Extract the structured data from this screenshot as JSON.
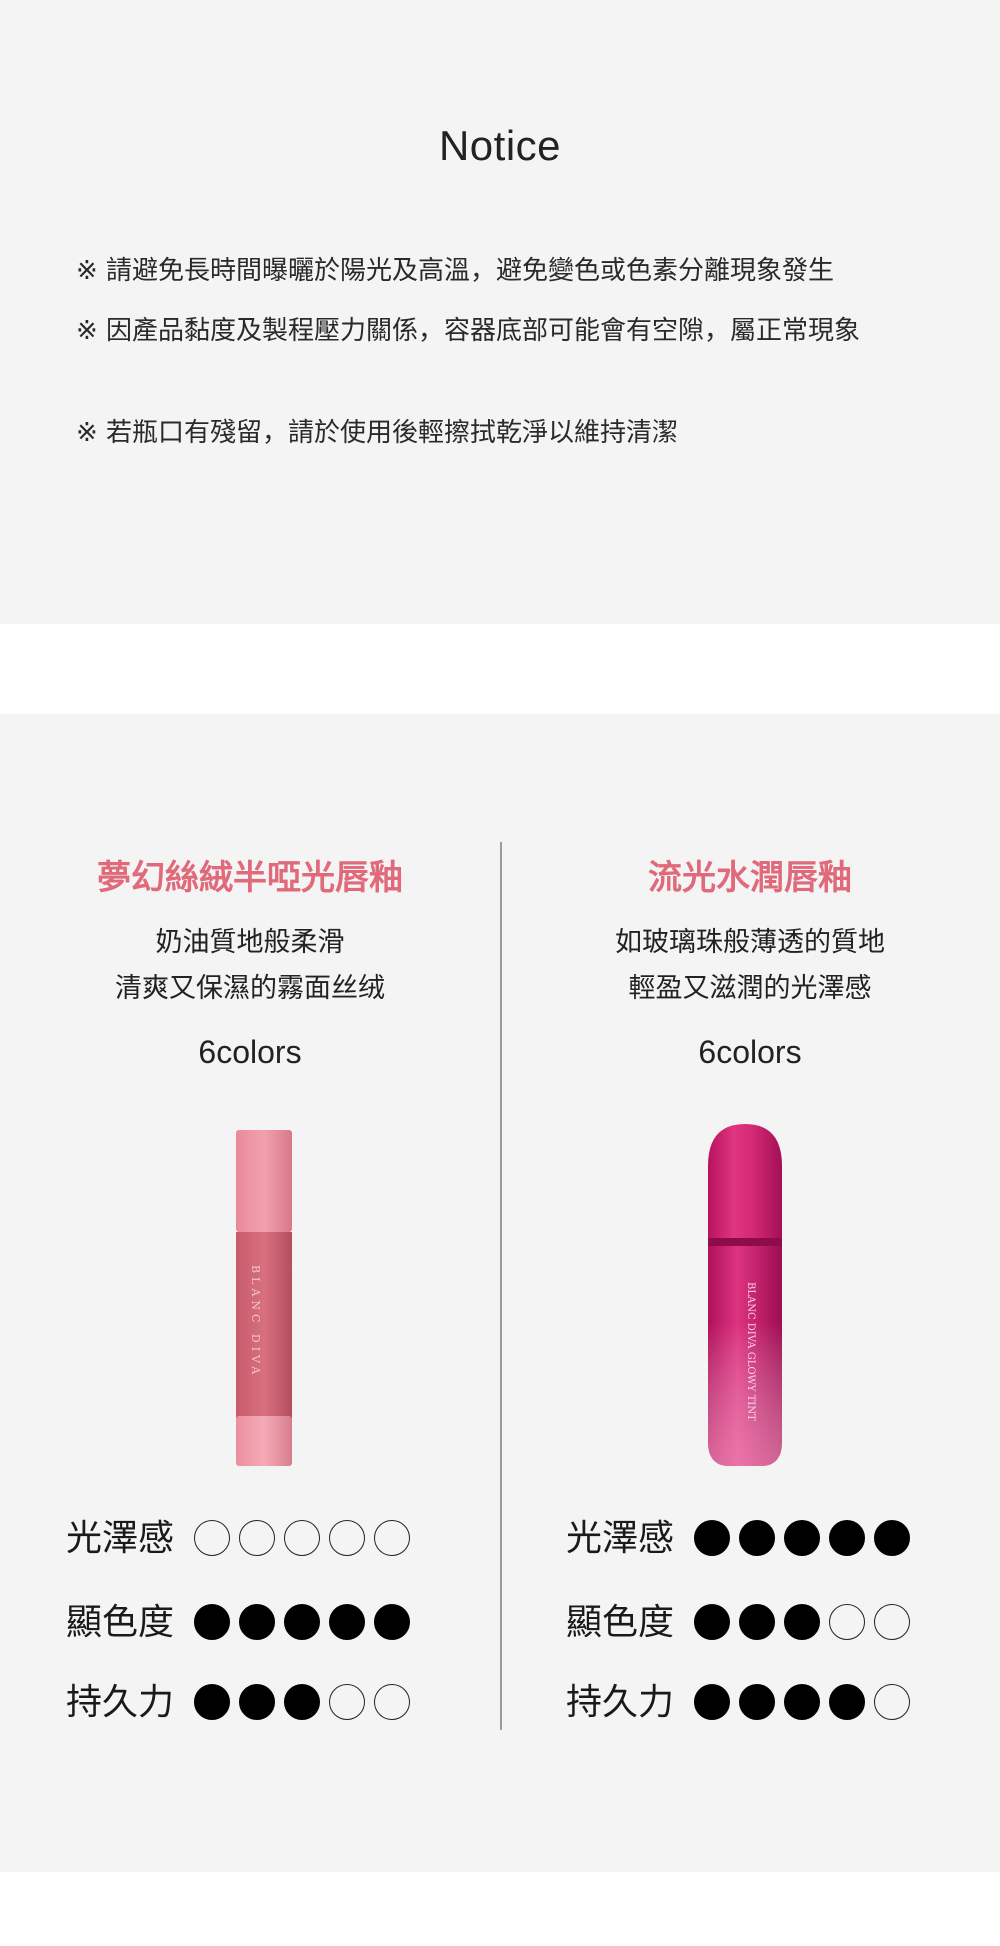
{
  "notice": {
    "title": "Notice",
    "items": [
      "※ 請避免長時間曝曬於陽光及高溫，避免變色或色素分離現象發生",
      "※ 因產品黏度及製程壓力關係，容器底部可能會有空隙，屬正常現象",
      "※ 若瓶口有殘留，請於使用後輕擦拭乾淨以維持清潔"
    ]
  },
  "products": [
    {
      "title": "夢幻絲絨半啞光唇釉",
      "desc1": "奶油質地般柔滑",
      "desc2": "清爽又保濕的霧面丝绒",
      "colors": "6colors",
      "bottle_text": "BLANC DIVA",
      "ratings": [
        {
          "label": "光澤感",
          "value": 0,
          "max": 5
        },
        {
          "label": "顯色度",
          "value": 5,
          "max": 5
        },
        {
          "label": "持久力",
          "value": 3,
          "max": 5
        }
      ]
    },
    {
      "title": "流光水潤唇釉",
      "desc1": "如玻璃珠般薄透的質地",
      "desc2": "輕盈又滋潤的光澤感",
      "colors": "6colors",
      "bottle_text": "BLANC DIVA GLOWY TINT",
      "ratings": [
        {
          "label": "光澤感",
          "value": 5,
          "max": 5
        },
        {
          "label": "顯色度",
          "value": 3,
          "max": 5
        },
        {
          "label": "持久力",
          "value": 4,
          "max": 5
        }
      ]
    }
  ]
}
